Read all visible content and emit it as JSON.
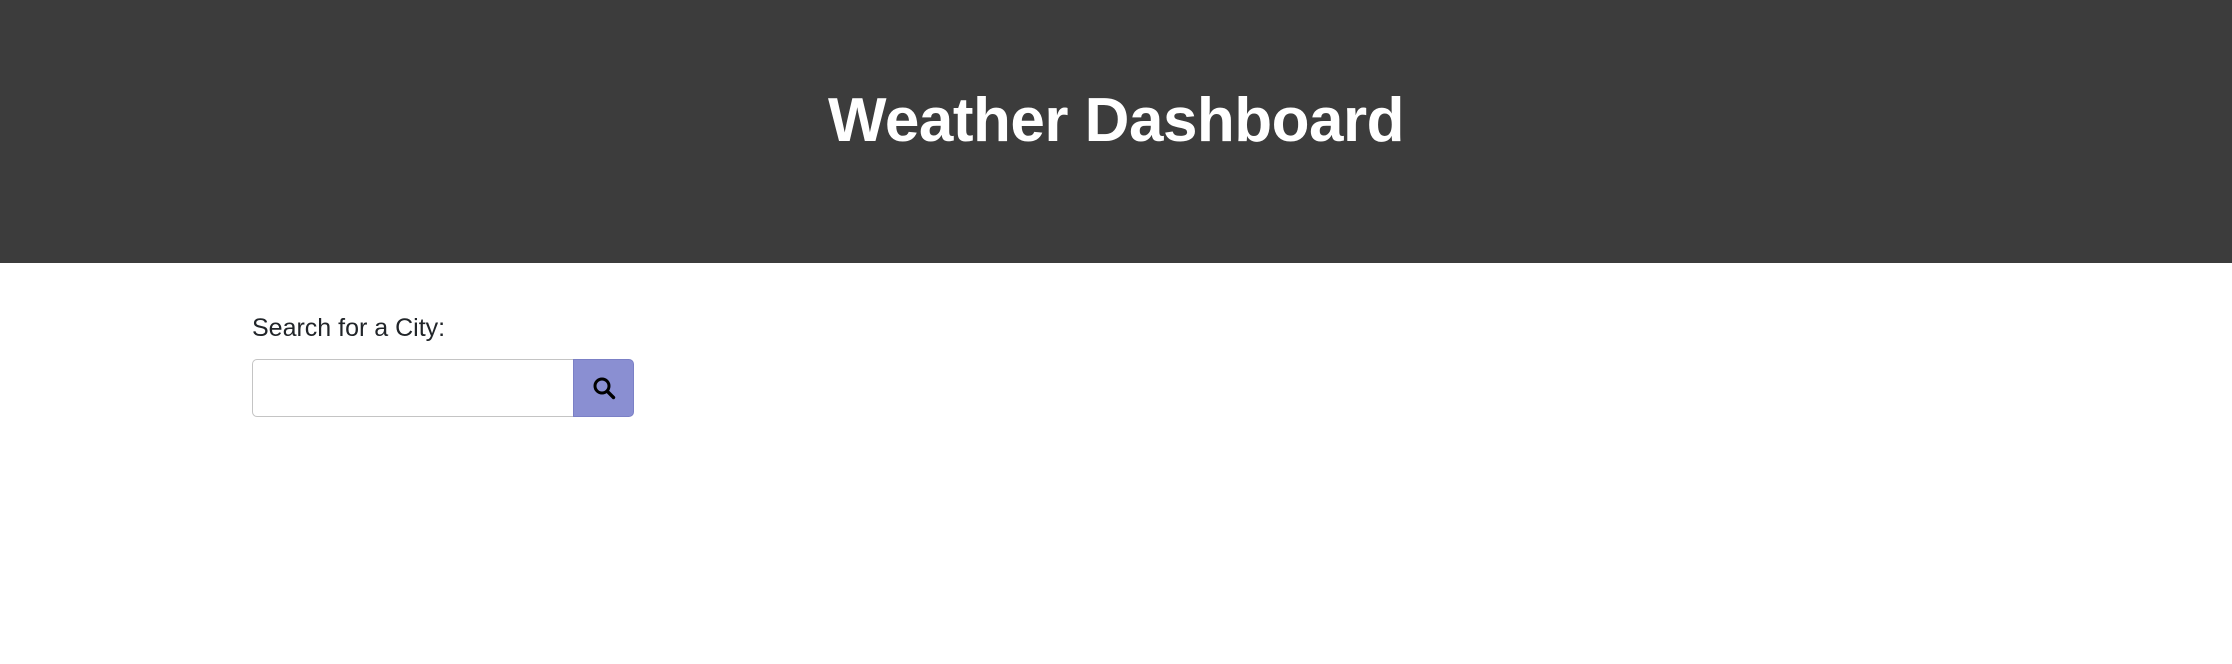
{
  "header": {
    "title": "Weather Dashboard"
  },
  "search": {
    "label": "Search for a City:",
    "input_value": "",
    "placeholder": "",
    "button_icon": "search-icon"
  },
  "colors": {
    "header_bg": "#3c3c3c",
    "header_text": "#ffffff",
    "button_bg": "#8a8fd2",
    "label_text": "#212529"
  }
}
